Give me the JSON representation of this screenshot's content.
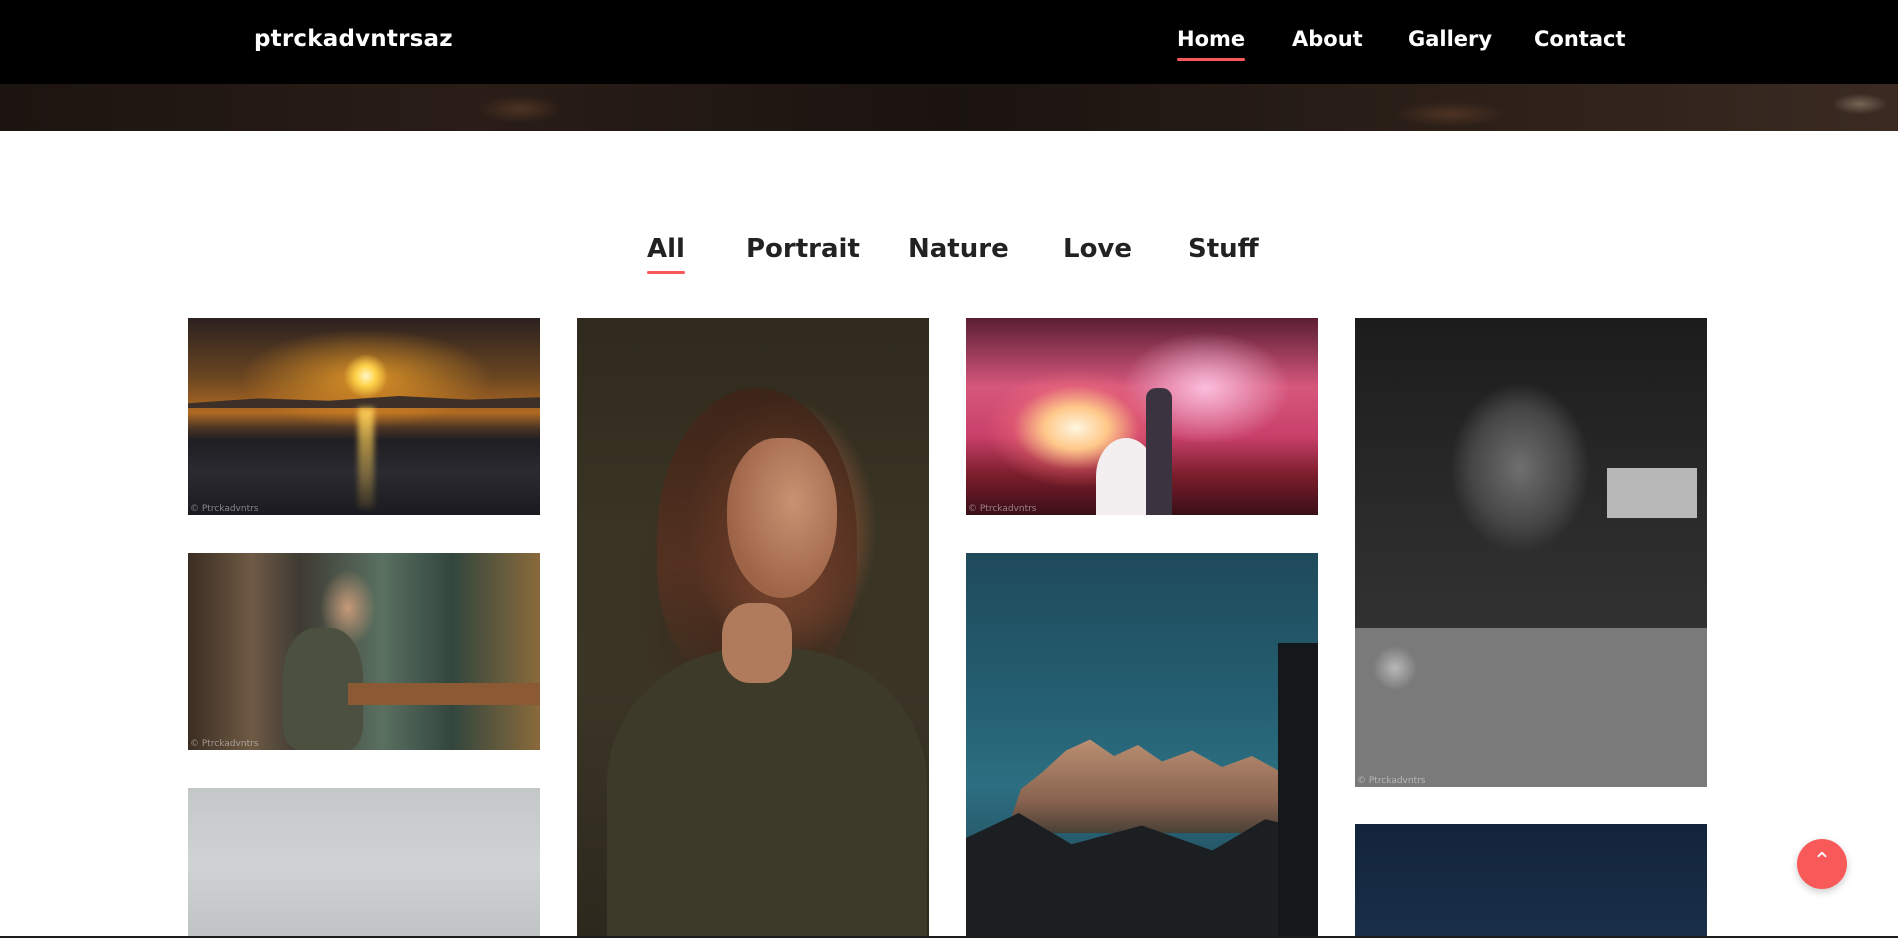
{
  "brand": "ptrckadvntrsaz",
  "nav": {
    "items": [
      {
        "label": "Home",
        "active": true
      },
      {
        "label": "About",
        "active": false
      },
      {
        "label": "Gallery",
        "active": false
      },
      {
        "label": "Contact",
        "active": false
      }
    ]
  },
  "filters": {
    "items": [
      {
        "label": "All",
        "active": true
      },
      {
        "label": "Portrait",
        "active": false
      },
      {
        "label": "Nature",
        "active": false
      },
      {
        "label": "Love",
        "active": false
      },
      {
        "label": "Stuff",
        "active": false
      }
    ]
  },
  "gallery": {
    "watermark": "© Ptrckadvntrs"
  },
  "colors": {
    "accent": "#f85a59",
    "navbar_bg": "#000000",
    "text_dark": "#222222"
  },
  "icons": {
    "back_to_top": "chevron-up-icon"
  }
}
